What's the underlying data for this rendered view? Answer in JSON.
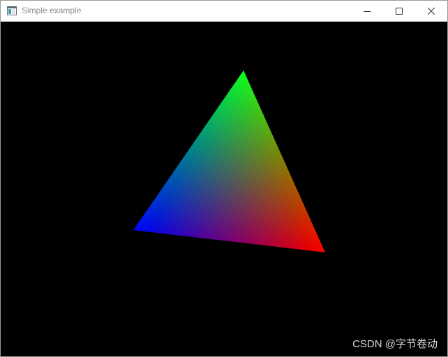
{
  "window": {
    "title": "Simple example",
    "controls": {
      "minimize_icon": "minimize-icon",
      "maximize_icon": "maximize-icon",
      "close_icon": "close-icon"
    }
  },
  "scene": {
    "background": "#000000",
    "triangle": {
      "top_color": "#00ff00",
      "left_color": "#0000ff",
      "right_color": "#ff0000"
    }
  },
  "watermark": {
    "text": "CSDN @字节卷动"
  }
}
